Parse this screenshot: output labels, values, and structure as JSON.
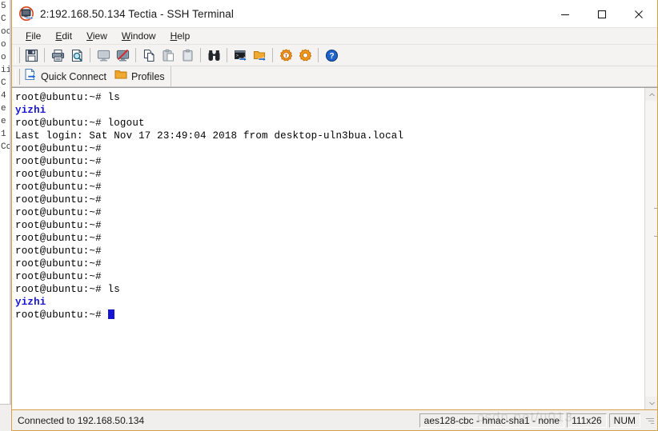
{
  "window": {
    "title": "2:192.168.50.134 Tectia - SSH Terminal",
    "app_icon": "ssh-terminal-icon",
    "border_color": "#d6a04a",
    "controls": [
      {
        "name": "minimize-button",
        "glyph": "minimize"
      },
      {
        "name": "maximize-button",
        "glyph": "maximize"
      },
      {
        "name": "close-button",
        "glyph": "close"
      }
    ]
  },
  "menubar": {
    "items": [
      {
        "accel": "F",
        "rest": "ile"
      },
      {
        "accel": "E",
        "rest": "dit"
      },
      {
        "accel": "V",
        "rest": "iew"
      },
      {
        "accel": "W",
        "rest": "indow"
      },
      {
        "accel": "H",
        "rest": "elp"
      }
    ]
  },
  "toolbar": {
    "groups": [
      {
        "buttons": [
          {
            "name": "save-button",
            "icon": "floppy-disk-icon"
          }
        ]
      },
      {
        "buttons": [
          {
            "name": "print-button",
            "icon": "printer-icon"
          },
          {
            "name": "print-preview-button",
            "icon": "print-preview-icon"
          }
        ]
      },
      {
        "buttons": [
          {
            "name": "connect-button",
            "icon": "monitor-icon"
          },
          {
            "name": "disconnect-button",
            "icon": "monitor-disconnect-icon"
          }
        ]
      },
      {
        "buttons": [
          {
            "name": "copy-button",
            "icon": "copy-icon"
          },
          {
            "name": "paste-button",
            "icon": "paste-icon"
          },
          {
            "name": "clipboard-button",
            "icon": "clipboard-icon"
          }
        ]
      },
      {
        "buttons": [
          {
            "name": "find-button",
            "icon": "binoculars-icon"
          }
        ]
      },
      {
        "buttons": [
          {
            "name": "new-terminal-button",
            "icon": "terminal-window-icon"
          },
          {
            "name": "new-file-transfer-button",
            "icon": "folder-transfer-icon"
          }
        ]
      },
      {
        "buttons": [
          {
            "name": "tectia-settings-button",
            "icon": "gear-t-icon"
          },
          {
            "name": "settings-button",
            "icon": "gear-icon"
          }
        ]
      },
      {
        "buttons": [
          {
            "name": "help-button",
            "icon": "help-circle-icon"
          }
        ]
      }
    ]
  },
  "quickbar": {
    "items": [
      {
        "name": "quick-connect-button",
        "label": "Quick Connect",
        "icon": "connect-document-icon"
      },
      {
        "name": "profiles-button",
        "label": "Profiles",
        "icon": "folder-icon"
      }
    ]
  },
  "terminal": {
    "prompt": "root@ubuntu:~#",
    "dir_color": "#1414d2",
    "cursor": "block",
    "lines": [
      {
        "type": "prompt",
        "text": "root@ubuntu:~# ls"
      },
      {
        "type": "dir",
        "text": "yizhi"
      },
      {
        "type": "prompt",
        "text": "root@ubuntu:~# logout"
      },
      {
        "type": "plain",
        "text": "Last login: Sat Nov 17 23:49:04 2018 from desktop-uln3bua.local"
      },
      {
        "type": "prompt",
        "text": "root@ubuntu:~#"
      },
      {
        "type": "prompt",
        "text": "root@ubuntu:~#"
      },
      {
        "type": "prompt",
        "text": "root@ubuntu:~#"
      },
      {
        "type": "prompt",
        "text": "root@ubuntu:~#"
      },
      {
        "type": "prompt",
        "text": "root@ubuntu:~#"
      },
      {
        "type": "prompt",
        "text": "root@ubuntu:~#"
      },
      {
        "type": "prompt",
        "text": "root@ubuntu:~#"
      },
      {
        "type": "prompt",
        "text": "root@ubuntu:~#"
      },
      {
        "type": "prompt",
        "text": "root@ubuntu:~#"
      },
      {
        "type": "prompt",
        "text": "root@ubuntu:~#"
      },
      {
        "type": "prompt",
        "text": "root@ubuntu:~#"
      },
      {
        "type": "prompt",
        "text": "root@ubuntu:~# ls"
      },
      {
        "type": "dir",
        "text": "yizhi"
      },
      {
        "type": "cursor",
        "text": "root@ubuntu:~# "
      }
    ]
  },
  "scrollbar": {
    "up_arrow": "chevron-up-icon",
    "down_arrow": "chevron-down-icon"
  },
  "statusbar": {
    "connection": "Connected to 192.168.50.134",
    "cipher": "aes128-cbc - hmac-sha1 - none",
    "size": "111x26",
    "num_lock": "NUM"
  },
  "watermark": {
    "text": "csdn.net/u013"
  },
  "background_window": {
    "fragments": [
      "5",
      "C",
      "",
      "",
      "oc",
      "",
      "o",
      "o",
      "ii",
      "",
      "C",
      "4",
      "",
      "e",
      "e",
      "",
      "1",
      "",
      "",
      "",
      "",
      "",
      "",
      "",
      "",
      "",
      "",
      "",
      "",
      "",
      "Co"
    ]
  }
}
